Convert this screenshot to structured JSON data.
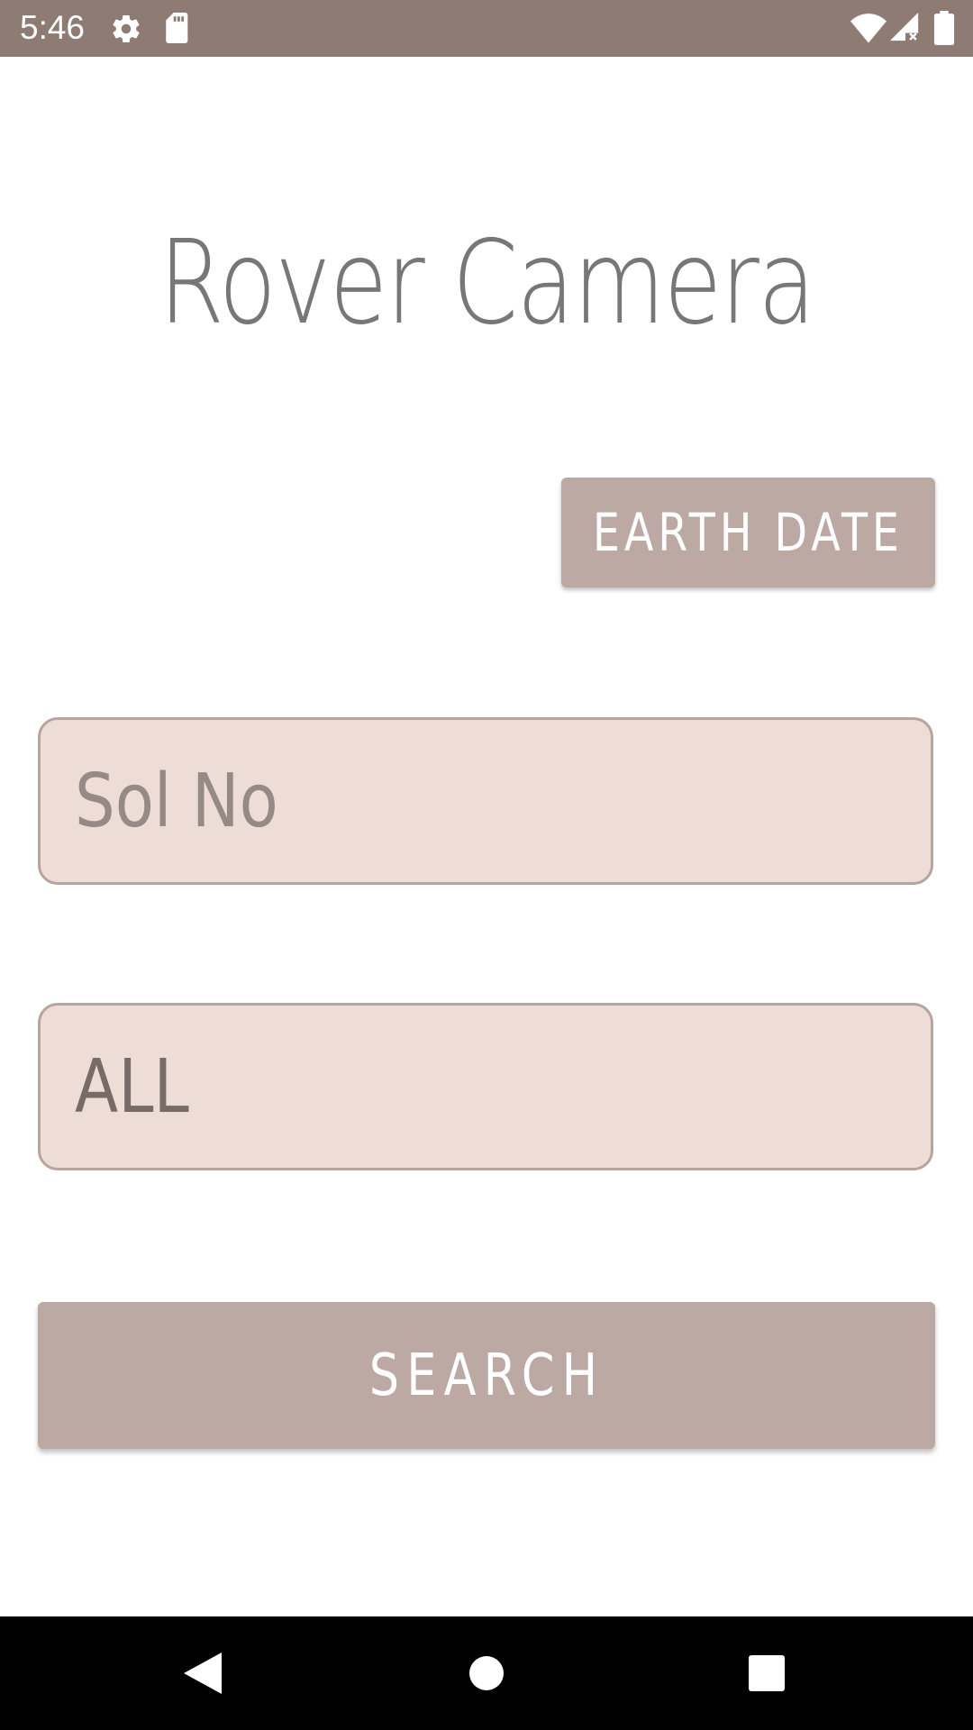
{
  "status_bar": {
    "time": "5:46",
    "icons": [
      "gear-icon",
      "sd-card-icon",
      "wifi-icon",
      "cell-signal-icon",
      "battery-icon"
    ],
    "background": "#8e7b74"
  },
  "header": {
    "title": "Rover Camera"
  },
  "controls": {
    "earth_date_label": "EARTH DATE",
    "sol_placeholder": "Sol No",
    "camera_value": "ALL",
    "search_label": "SEARCH"
  },
  "colors": {
    "button": "#bca9a3",
    "field_background": "#eedcd6",
    "field_border": "#b8a49f",
    "title_text": "#777777"
  },
  "nav_bar": {
    "icons": [
      "back-icon",
      "home-icon",
      "recents-icon"
    ]
  }
}
